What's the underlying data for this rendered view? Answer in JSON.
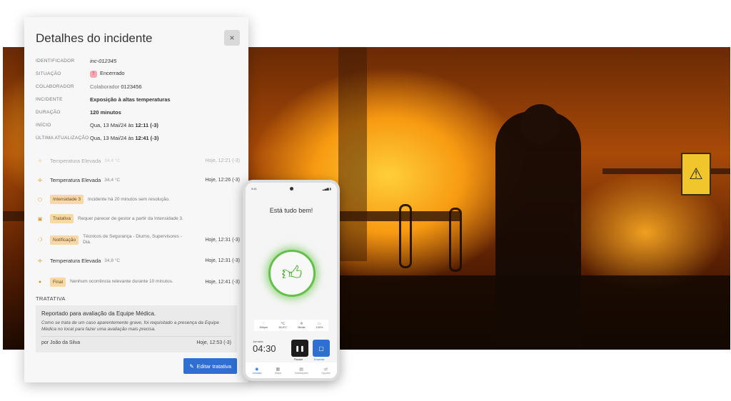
{
  "panel": {
    "title": "Detalhes do incidente",
    "close_icon": "×",
    "info": {
      "id_label": "IDENTIFICADOR",
      "id_value": "inc-012345",
      "status_label": "SITUAÇÃO",
      "status_value": "Encerrado",
      "colab_label": "COLABORADOR",
      "colab_prefix": "Colaborador",
      "colab_value": "0123456",
      "incident_label": "INCIDENTE",
      "incident_value": "Exposição à altas temperaturas",
      "duration_label": "DURAÇÃO",
      "duration_value": "120 minutos",
      "start_label": "INÍCIO",
      "start_prefix": "Qua, 13 Mai/24 às",
      "start_time": "12:11 (-3)",
      "update_label": "ÚLTIMA ATUALIZAÇÃO",
      "update_prefix": "Qua, 13 Mai/24 às",
      "update_time": "12:41 (-3)"
    },
    "timeline": [
      {
        "title": "Temperatura Elevada",
        "meta": "34,4 °C",
        "time": "Hoje, 12:21 (-3)"
      },
      {
        "title": "Temperatura Elevada",
        "meta": "34,4 °C",
        "time": "Hoje, 12:26 (-3)"
      },
      {
        "badge": "Intensidade 3",
        "desc": "Incidente há 20 minutos sem resolução."
      },
      {
        "badge": "Tratativa",
        "desc": "Requer parecer de gestor a partir da Intensidade 3."
      },
      {
        "badge": "Notificação",
        "desc": "Técnicos de Segurança - Diurno, Supervisores - Dia.",
        "time": "Hoje, 12:31 (-3)"
      },
      {
        "title": "Temperatura Elevada",
        "meta": "34,8 °C",
        "time": "Hoje, 12:31 (-3)"
      },
      {
        "badge": "Final",
        "desc": "Nenhum ocorrência relevante durante 10 minutos.",
        "time": "Hoje, 12:41 (-3)"
      }
    ],
    "tratativa": {
      "label": "TRATATIVA",
      "title": "Reportado para avaliação da Equipe Médica.",
      "text": "Como se trata de um caso aparentemente grave, foi requisitado a presença da Equipe Médica no local para fazer uma avaliação mais precisa.",
      "author": "por João da Silva",
      "time": "Hoje, 12:53 (-3)"
    },
    "edit_button": "Editar tratativa"
  },
  "phone": {
    "status_time": "9:41",
    "heading": "Está tudo bem!",
    "stats": [
      {
        "value": "60bpm",
        "icon": "♡"
      },
      {
        "value": "35,8°C",
        "icon": "℃"
      },
      {
        "value": "Média",
        "icon": "✲"
      },
      {
        "value": "100%",
        "icon": "▭"
      }
    ],
    "jornada_label": "Jornada",
    "jornada_time": "04:30",
    "pause_label": "Pausar",
    "stop_label": "Encerrar",
    "nav": [
      {
        "label": "Jornada",
        "icon": "◉"
      },
      {
        "label": "Mapa",
        "icon": "▦"
      },
      {
        "label": "Solicitações",
        "icon": "▤"
      },
      {
        "label": "Opções",
        "icon": "⇄"
      }
    ]
  }
}
